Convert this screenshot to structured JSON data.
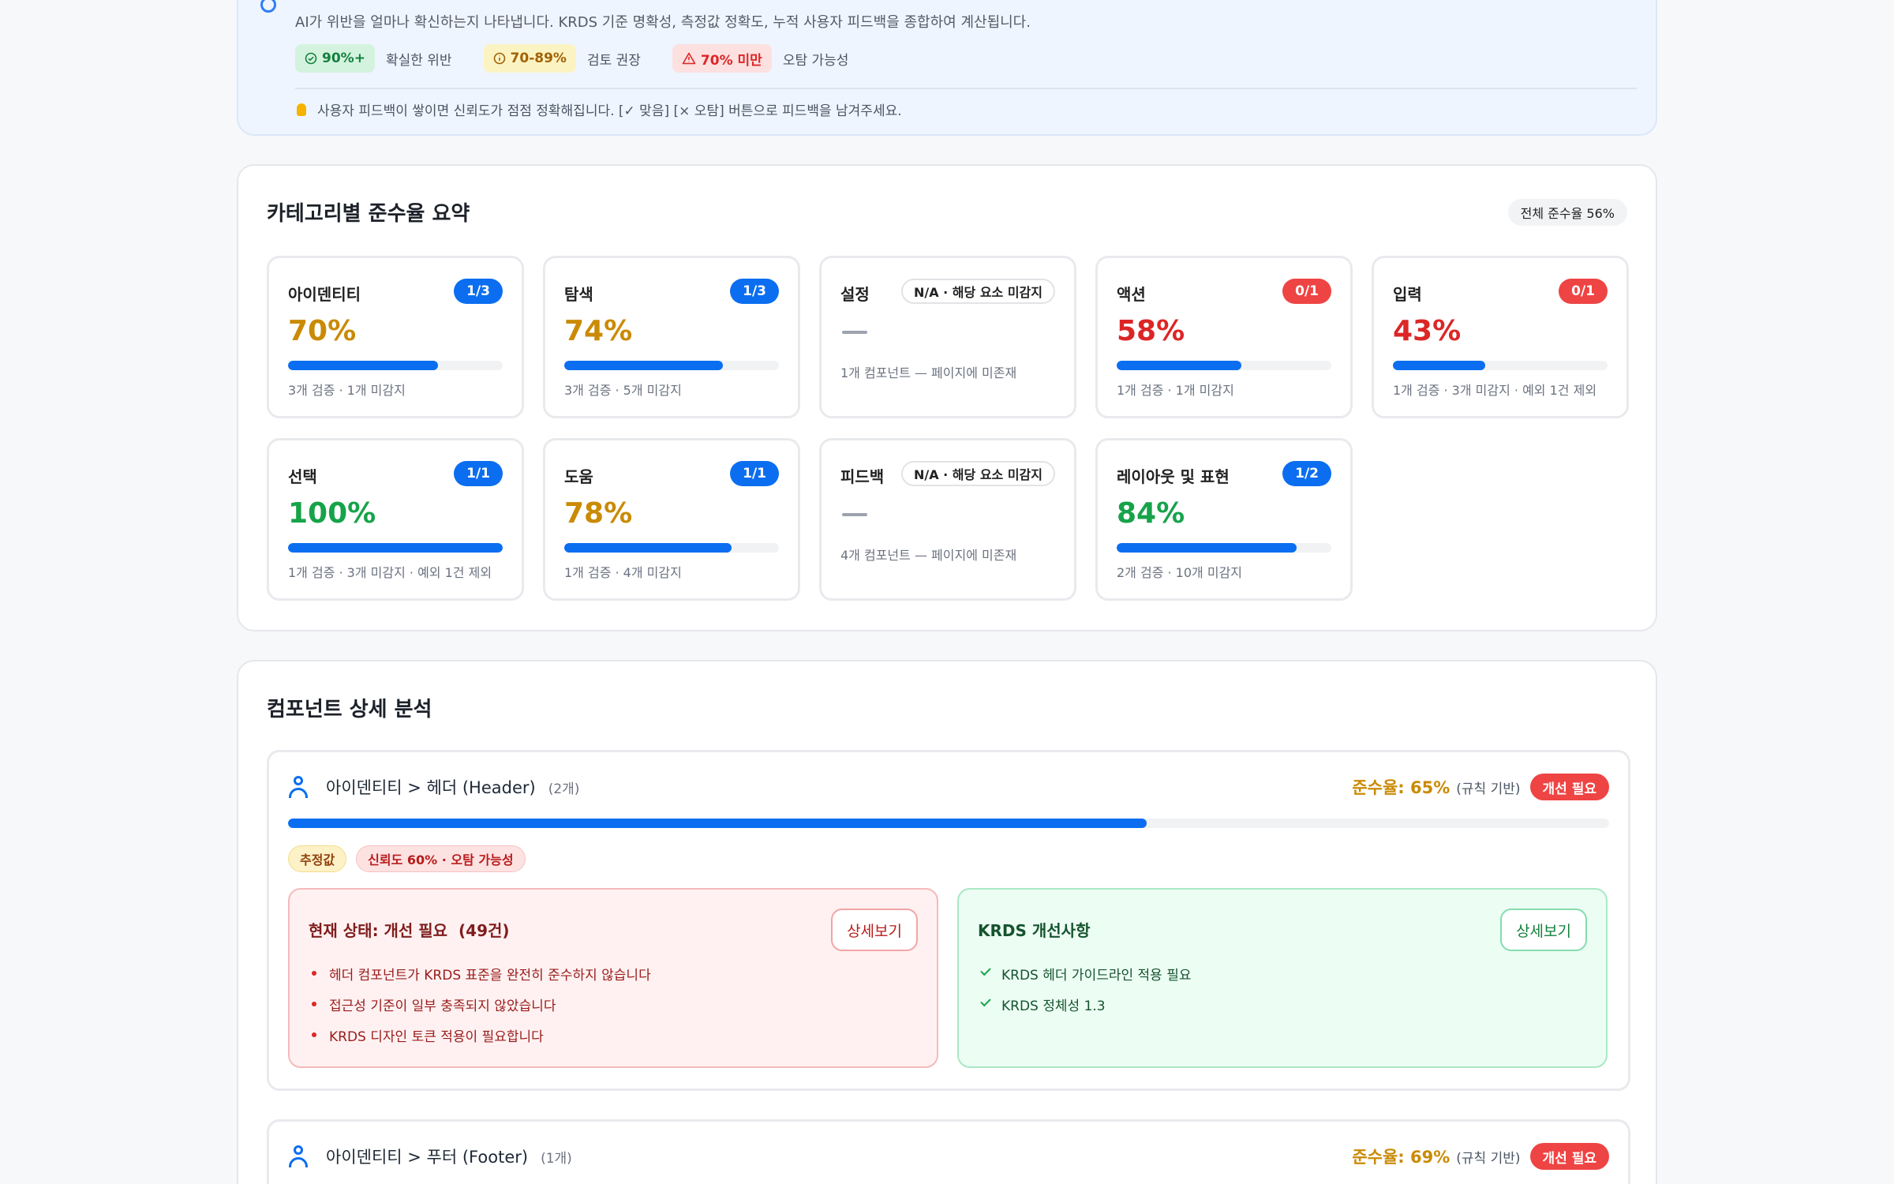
{
  "confidence": {
    "description": "AI가 위반을 얼마나 확신하는지 나타냅니다. KRDS 기준 명확성, 측정값 정확도, 누적 사용자 피드백을 종합하여 계산됩니다.",
    "legend": [
      {
        "badge": "90%+",
        "text": "확실한 위반",
        "tone": "green",
        "icon": "check-circle-icon"
      },
      {
        "badge": "70-89%",
        "text": "검토 권장",
        "tone": "yellow",
        "icon": "info-circle-icon"
      },
      {
        "badge": "70% 미만",
        "text": "오탐 가능성",
        "tone": "red",
        "icon": "warning-triangle-icon"
      }
    ],
    "tip": "사용자 피드백이 쌓이면 신뢰도가 점점 정확해집니다. [✓ 맞음] [× 오탐] 버튼으로 피드백을 남겨주세요.",
    "tip_icon": "lightbulb-icon"
  },
  "category_summary": {
    "title": "카테고리별 준수율 요약",
    "overall": "전체 준수율 56%",
    "cards": [
      {
        "name": "아이덴티티",
        "badge": "1/3",
        "badge_tone": "blue",
        "pct": "70%",
        "pct_tone": "yellow",
        "progress": 0.7,
        "meta": "3개 검증 · 1개 미감지"
      },
      {
        "name": "탐색",
        "badge": "1/3",
        "badge_tone": "blue",
        "pct": "74%",
        "pct_tone": "yellow",
        "progress": 0.74,
        "meta": "3개 검증 · 5개 미감지"
      },
      {
        "name": "설정",
        "badge": "N/A · 해당 요소 미감지",
        "badge_tone": "na",
        "pct": "",
        "pct_tone": "na",
        "progress": null,
        "meta": "1개 컴포넌트 — 페이지에 미존재"
      },
      {
        "name": "액션",
        "badge": "0/1",
        "badge_tone": "red",
        "pct": "58%",
        "pct_tone": "red",
        "progress": 0.58,
        "meta": "1개 검증 · 1개 미감지"
      },
      {
        "name": "입력",
        "badge": "0/1",
        "badge_tone": "red",
        "pct": "43%",
        "pct_tone": "red",
        "progress": 0.43,
        "meta": "1개 검증 · 3개 미감지 · 예외 1건 제외"
      },
      {
        "name": "선택",
        "badge": "1/1",
        "badge_tone": "blue",
        "pct": "100%",
        "pct_tone": "green",
        "progress": 1.0,
        "meta": "1개 검증 · 3개 미감지 · 예외 1건 제외"
      },
      {
        "name": "도움",
        "badge": "1/1",
        "badge_tone": "blue",
        "pct": "78%",
        "pct_tone": "yellow",
        "progress": 0.78,
        "meta": "1개 검증 · 4개 미감지"
      },
      {
        "name": "피드백",
        "badge": "N/A · 해당 요소 미감지",
        "badge_tone": "na",
        "pct": "",
        "pct_tone": "na",
        "progress": null,
        "meta": "4개 컴포넌트 — 페이지에 미존재"
      },
      {
        "name": "레이아웃 및 표현",
        "badge": "1/2",
        "badge_tone": "blue",
        "pct": "84%",
        "pct_tone": "green",
        "progress": 0.84,
        "meta": "2개 검증 · 10개 미감지"
      }
    ]
  },
  "component_detail": {
    "title": "컴포넌트 상세 분석",
    "components": [
      {
        "path": "아이덴티티 > 헤더 (Header)",
        "count": "(2개)",
        "rate": "준수율: 65%",
        "basis": "(규칙 기반)",
        "status_badge": "개선 필요",
        "progress": 0.65,
        "tags": [
          "추정값",
          "신뢰도 60% · 오탐 가능성"
        ],
        "current": {
          "title": "현재 상태: 개선 필요",
          "count": "(49건)",
          "button": "상세보기",
          "items": [
            "헤더 컴포넌트가 KRDS 표준을 완전히 준수하지 않습니다",
            "접근성 기준이 일부 충족되지 않았습니다",
            "KRDS 디자인 토큰 적용이 필요합니다"
          ]
        },
        "improvement": {
          "title": "KRDS 개선사항",
          "button": "상세보기",
          "items": [
            "KRDS 헤더 가이드라인 적용 필요",
            "KRDS 정체성 1.3"
          ]
        }
      },
      {
        "path": "아이덴티티 > 푸터 (Footer)",
        "count": "(1개)",
        "rate": "준수율: 69%",
        "basis": "(규칙 기반)",
        "status_badge": "개선 필요"
      }
    ]
  },
  "colors": {
    "primary": "#0b6ef0",
    "danger": "#ef4444",
    "warning": "#ca8a04",
    "success": "#16a34a"
  }
}
